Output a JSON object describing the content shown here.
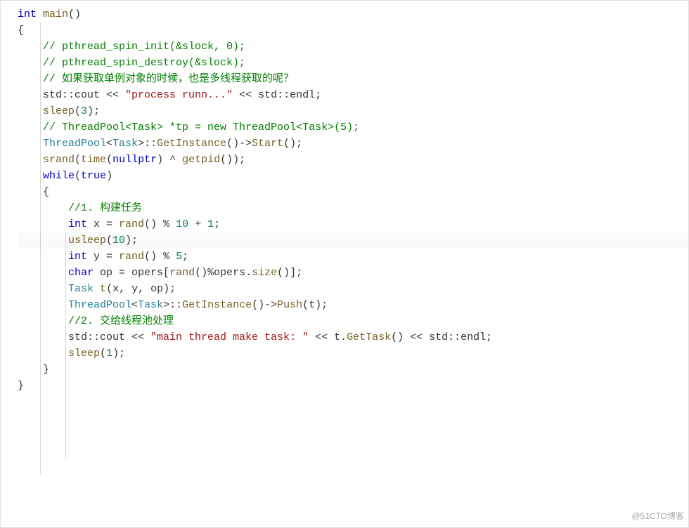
{
  "watermark": "@51CTO博客",
  "code": {
    "l1": {
      "a": "int",
      "b": " ",
      "c": "main",
      "d": "()"
    },
    "l2": "{",
    "l3": "    // pthread_spin_init(&slock, 0);",
    "l4": "    // pthread_spin_destroy(&slock);",
    "l5": "",
    "l6": "    // 如果获取单例对象的时候，也是多线程获取的呢？",
    "l7": {
      "a": "    std::cout << ",
      "b": "\"process runn...\"",
      "c": " << std::endl;"
    },
    "l8": {
      "a": "    ",
      "b": "sleep",
      "c": "(",
      "d": "3",
      "e": ");"
    },
    "l9": "    // ThreadPool<Task> *tp = new ThreadPool<Task>(5);",
    "l10": {
      "a": "    ",
      "b": "ThreadPool",
      "c": "<",
      "d": "Task",
      "e": ">::",
      "f": "GetInstance",
      "g": "()->",
      "h": "Start",
      "i": "();"
    },
    "l11": {
      "a": "    ",
      "b": "srand",
      "c": "(",
      "d": "time",
      "e": "(",
      "f": "nullptr",
      "g": ") ^ ",
      "h": "getpid",
      "i": "());"
    },
    "l12": "",
    "l13": {
      "a": "    ",
      "b": "while",
      "c": "(",
      "d": "true",
      "e": ")"
    },
    "l14": "    {",
    "l15": "        //1. 构建任务",
    "l16": {
      "a": "        ",
      "b": "int",
      "c": " x = ",
      "d": "rand",
      "e": "() % ",
      "f": "10",
      "g": " + ",
      "h": "1",
      "i": ";"
    },
    "l17": {
      "a": "        ",
      "b": "usleep",
      "c": "(",
      "d": "10",
      "e": ");"
    },
    "l18": {
      "a": "        ",
      "b": "int",
      "c": " y = ",
      "d": "rand",
      "e": "() % ",
      "f": "5",
      "g": ";"
    },
    "l19": {
      "a": "        ",
      "b": "char",
      "c": " op = opers[",
      "d": "rand",
      "e": "()%opers.",
      "f": "size",
      "g": "()];"
    },
    "l20": "",
    "l21": {
      "a": "        ",
      "b": "Task",
      "c": " ",
      "d": "t",
      "e": "(x, y, op);"
    },
    "l22": {
      "a": "        ",
      "b": "ThreadPool",
      "c": "<",
      "d": "Task",
      "e": ">::",
      "f": "GetInstance",
      "g": "()->",
      "h": "Push",
      "i": "(t);"
    },
    "l23": "        //2. 交给线程池处理",
    "l24": {
      "a": "        std::cout << ",
      "b": "\"main thread make task: \"",
      "c": " << t.",
      "d": "GetTask",
      "e": "() << std::endl;"
    },
    "l25": "",
    "l26": {
      "a": "        ",
      "b": "sleep",
      "c": "(",
      "d": "1",
      "e": ");"
    },
    "l27": "    }",
    "l28": "}"
  }
}
